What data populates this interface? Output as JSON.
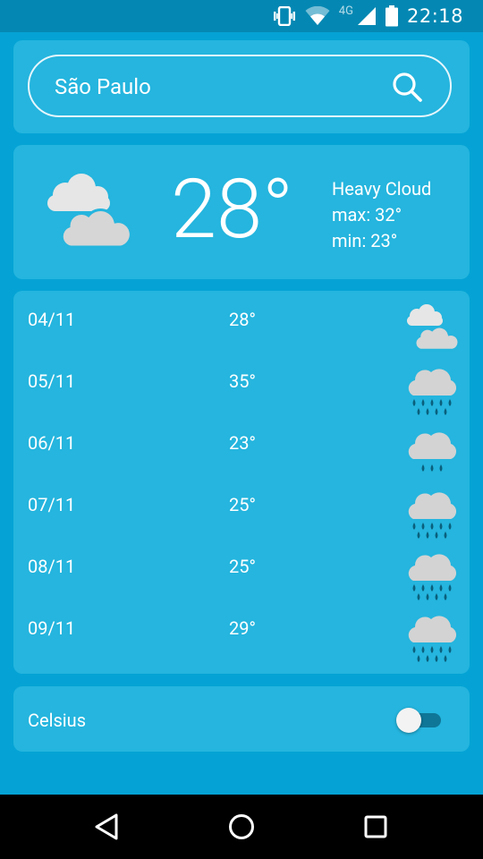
{
  "status_bar": {
    "time": "22:18",
    "network": "4G"
  },
  "search": {
    "query": "São Paulo"
  },
  "current": {
    "temperature": "28°",
    "condition": "Heavy Cloud",
    "max": "max:  32°",
    "min": "min:  23°",
    "icon": "heavy-cloud-icon"
  },
  "forecast": [
    {
      "date": "04/11",
      "temp": "28°",
      "icon": "heavy-cloud-icon"
    },
    {
      "date": "05/11",
      "temp": "35°",
      "icon": "heavy-rain-icon"
    },
    {
      "date": "06/11",
      "temp": "23°",
      "icon": "light-rain-icon"
    },
    {
      "date": "07/11",
      "temp": "25°",
      "icon": "heavy-rain-icon"
    },
    {
      "date": "08/11",
      "temp": "25°",
      "icon": "heavy-rain-icon"
    },
    {
      "date": "09/11",
      "temp": "29°",
      "icon": "heavy-rain-icon"
    }
  ],
  "units": {
    "label": "Celsius",
    "enabled": false
  },
  "colors": {
    "background": "#05a3d5",
    "card": "#25b5de",
    "status_bar": "#0488b3"
  }
}
